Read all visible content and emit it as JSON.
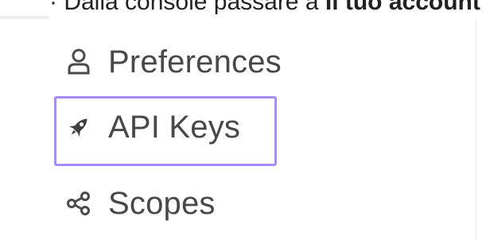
{
  "instruction": {
    "prefix": "· Dalla console passare a ",
    "bold": "Il tuo account"
  },
  "menu": {
    "items": [
      {
        "label": "Preferences",
        "icon": "user-icon"
      },
      {
        "label": "API Keys",
        "icon": "rocket-icon"
      },
      {
        "label": "Scopes",
        "icon": "share-nodes-icon"
      }
    ]
  },
  "colors": {
    "highlight": "#a78bfa",
    "text": "#484848"
  }
}
